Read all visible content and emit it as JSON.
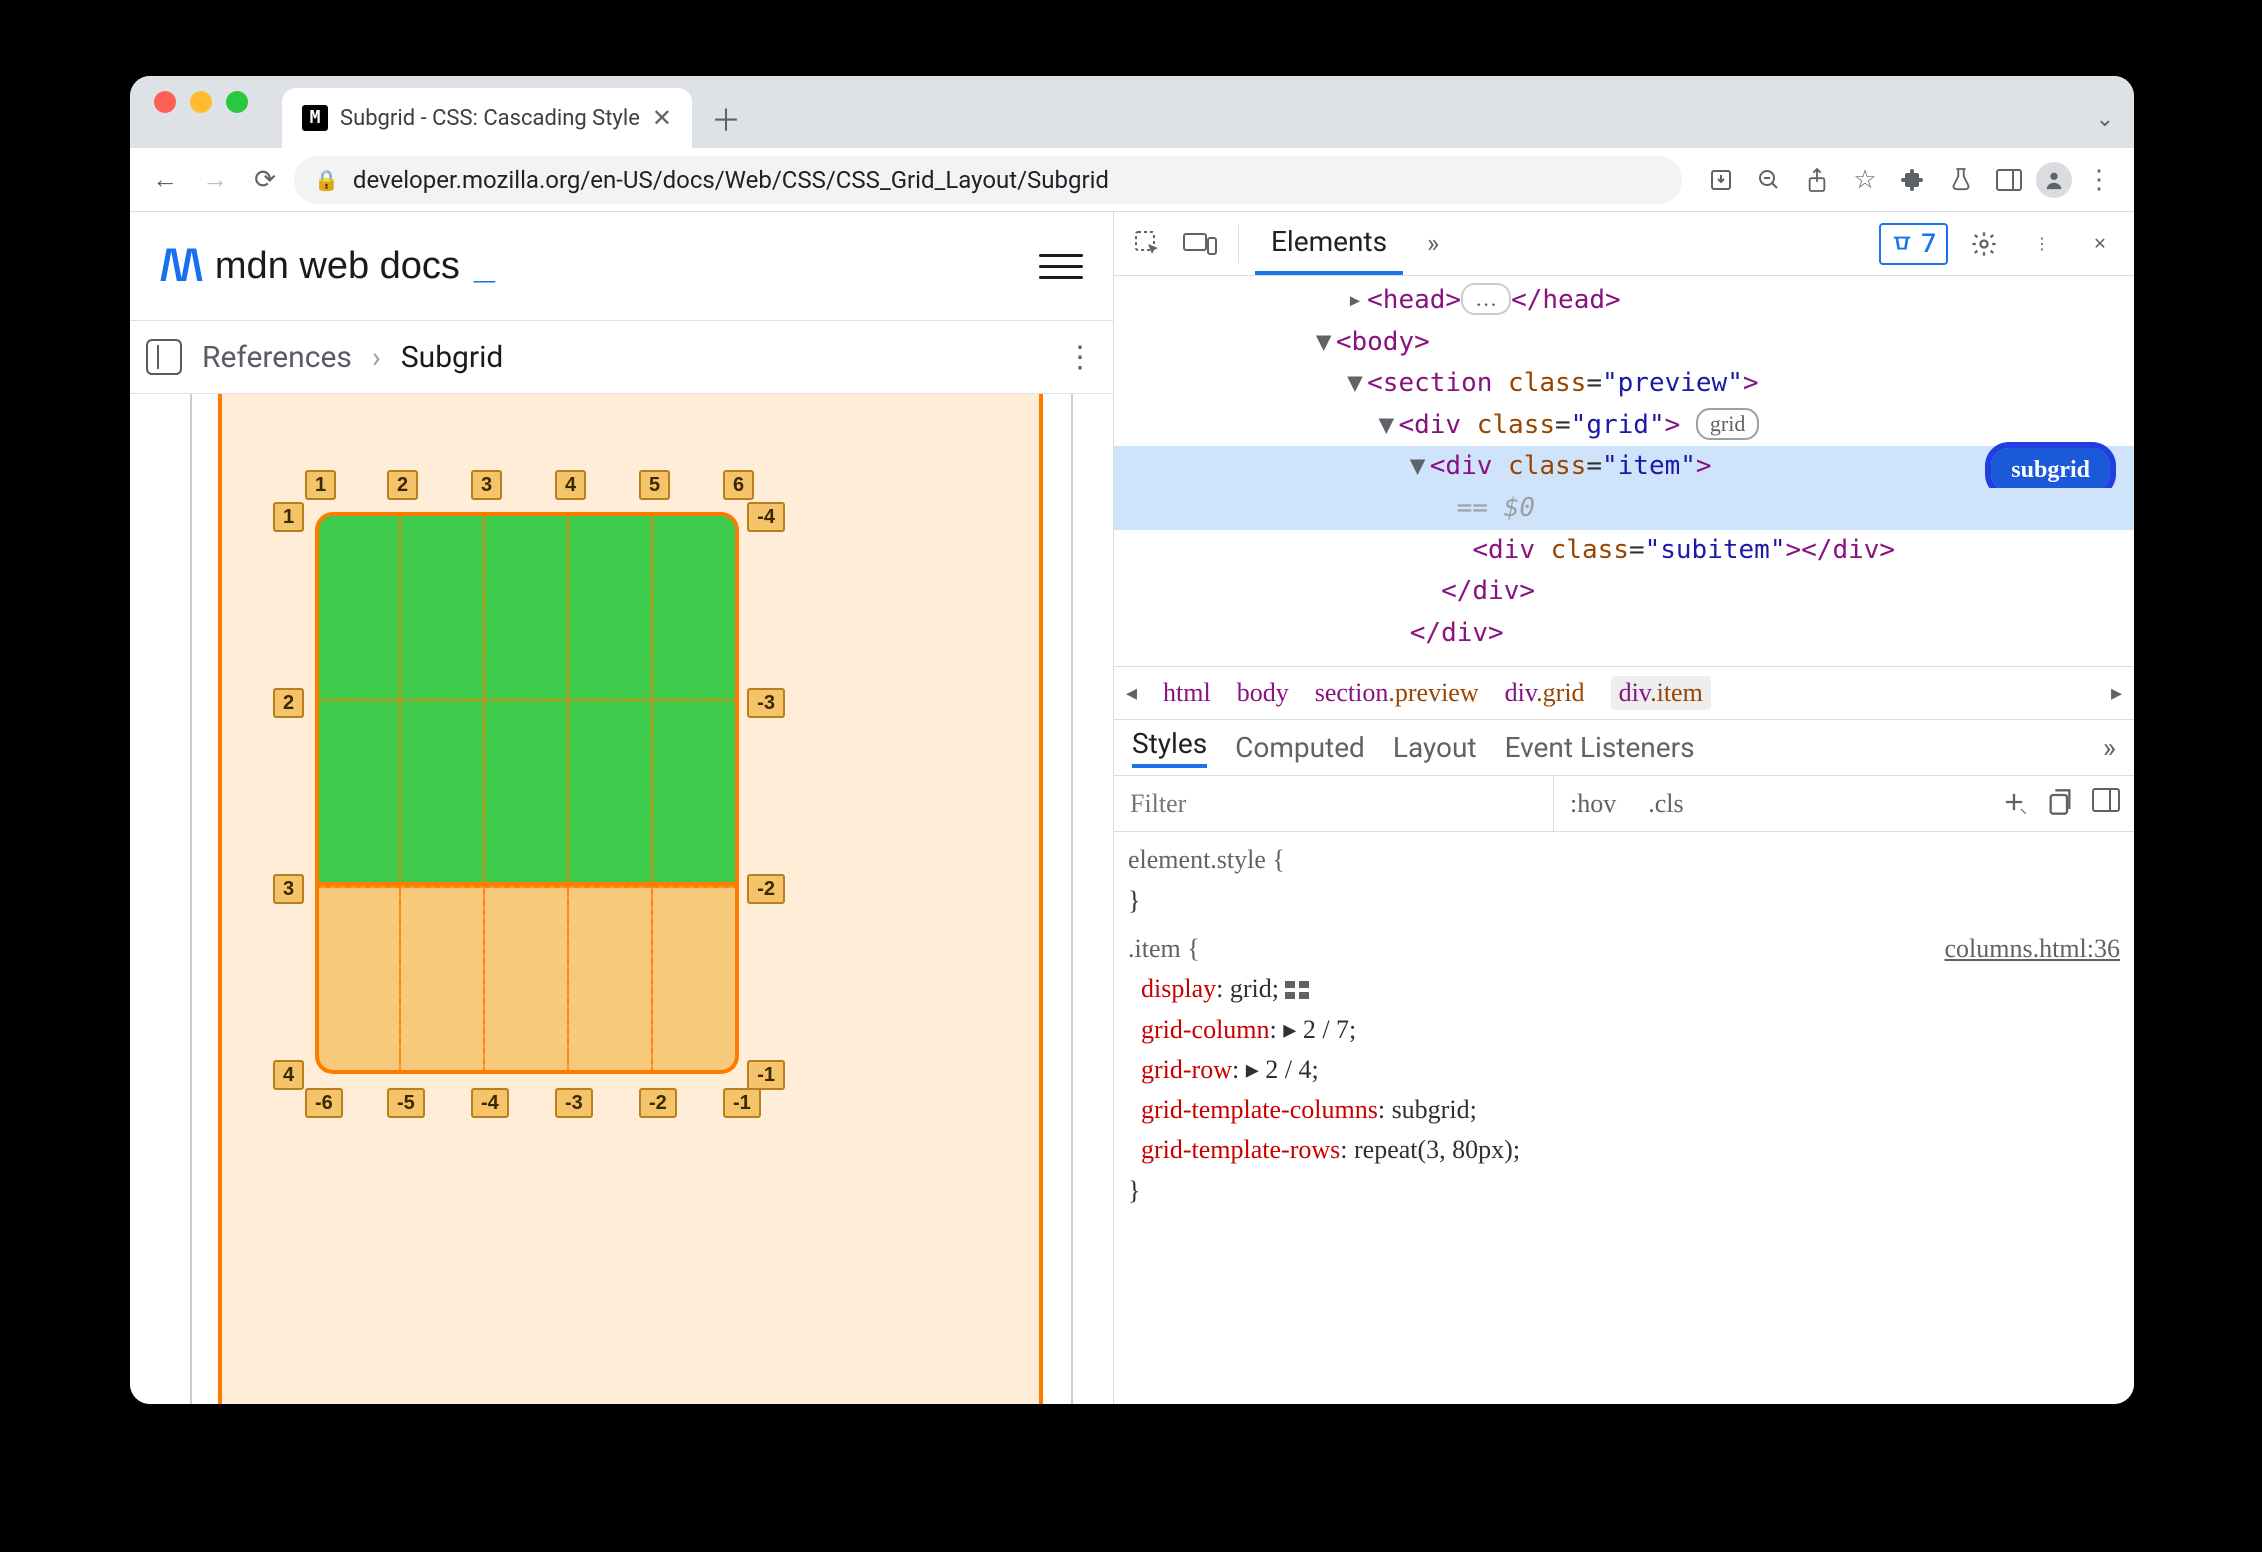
{
  "browser": {
    "tab_title": "Subgrid - CSS: Cascading Style",
    "url": "developer.mozilla.org/en-US/docs/Web/CSS/CSS_Grid_Layout/Subgrid",
    "issue_count": "7"
  },
  "mdn": {
    "brand": "mdn web docs",
    "breadcrumb1": "References",
    "breadcrumb2": "Subgrid"
  },
  "grid_annotations": {
    "top": [
      "1",
      "2",
      "3",
      "4",
      "5",
      "6"
    ],
    "left": [
      "1",
      "2",
      "3",
      "4"
    ],
    "right": [
      "-4",
      "-3",
      "-2",
      "-1"
    ],
    "bottom": [
      "-6",
      "-5",
      "-4",
      "-3",
      "-2",
      "-1"
    ]
  },
  "devtools": {
    "main_tab": "Elements",
    "dom": {
      "head_open": "<head>",
      "head_dots": "…",
      "head_close": "</head>",
      "body": "<body>",
      "section_open": "<section ",
      "class_attr": "class",
      "preview_val": "\"preview\"",
      "div_open": "<div ",
      "grid_val": "\"grid\"",
      "grid_badge": "grid",
      "item_val": "\"item\"",
      "subgrid_badge": "subgrid",
      "eq0": "== $0",
      "subitem_val": "\"subitem\"",
      "div_close": "</div>",
      "close_tag": ">"
    },
    "breadcrumb": {
      "items": [
        "html",
        "body",
        "section.preview",
        "div.grid",
        "div.item"
      ]
    },
    "sub_tabs": [
      "Styles",
      "Computed",
      "Layout",
      "Event Listeners"
    ],
    "filter_placeholder": "Filter",
    "hov": ":hov",
    "cls": ".cls",
    "styles": {
      "element_style": "element.style {",
      "brace_close": "}",
      "selector": ".item {",
      "source": "columns.html:36",
      "rules": [
        {
          "prop": "display",
          "val": "grid",
          "glyph": true
        },
        {
          "prop": "grid-column",
          "val": "▸ 2 / 7"
        },
        {
          "prop": "grid-row",
          "val": "▸ 2 / 4"
        },
        {
          "prop": "grid-template-columns",
          "val": "subgrid"
        },
        {
          "prop": "grid-template-rows",
          "val": "repeat(3, 80px)"
        }
      ]
    }
  }
}
